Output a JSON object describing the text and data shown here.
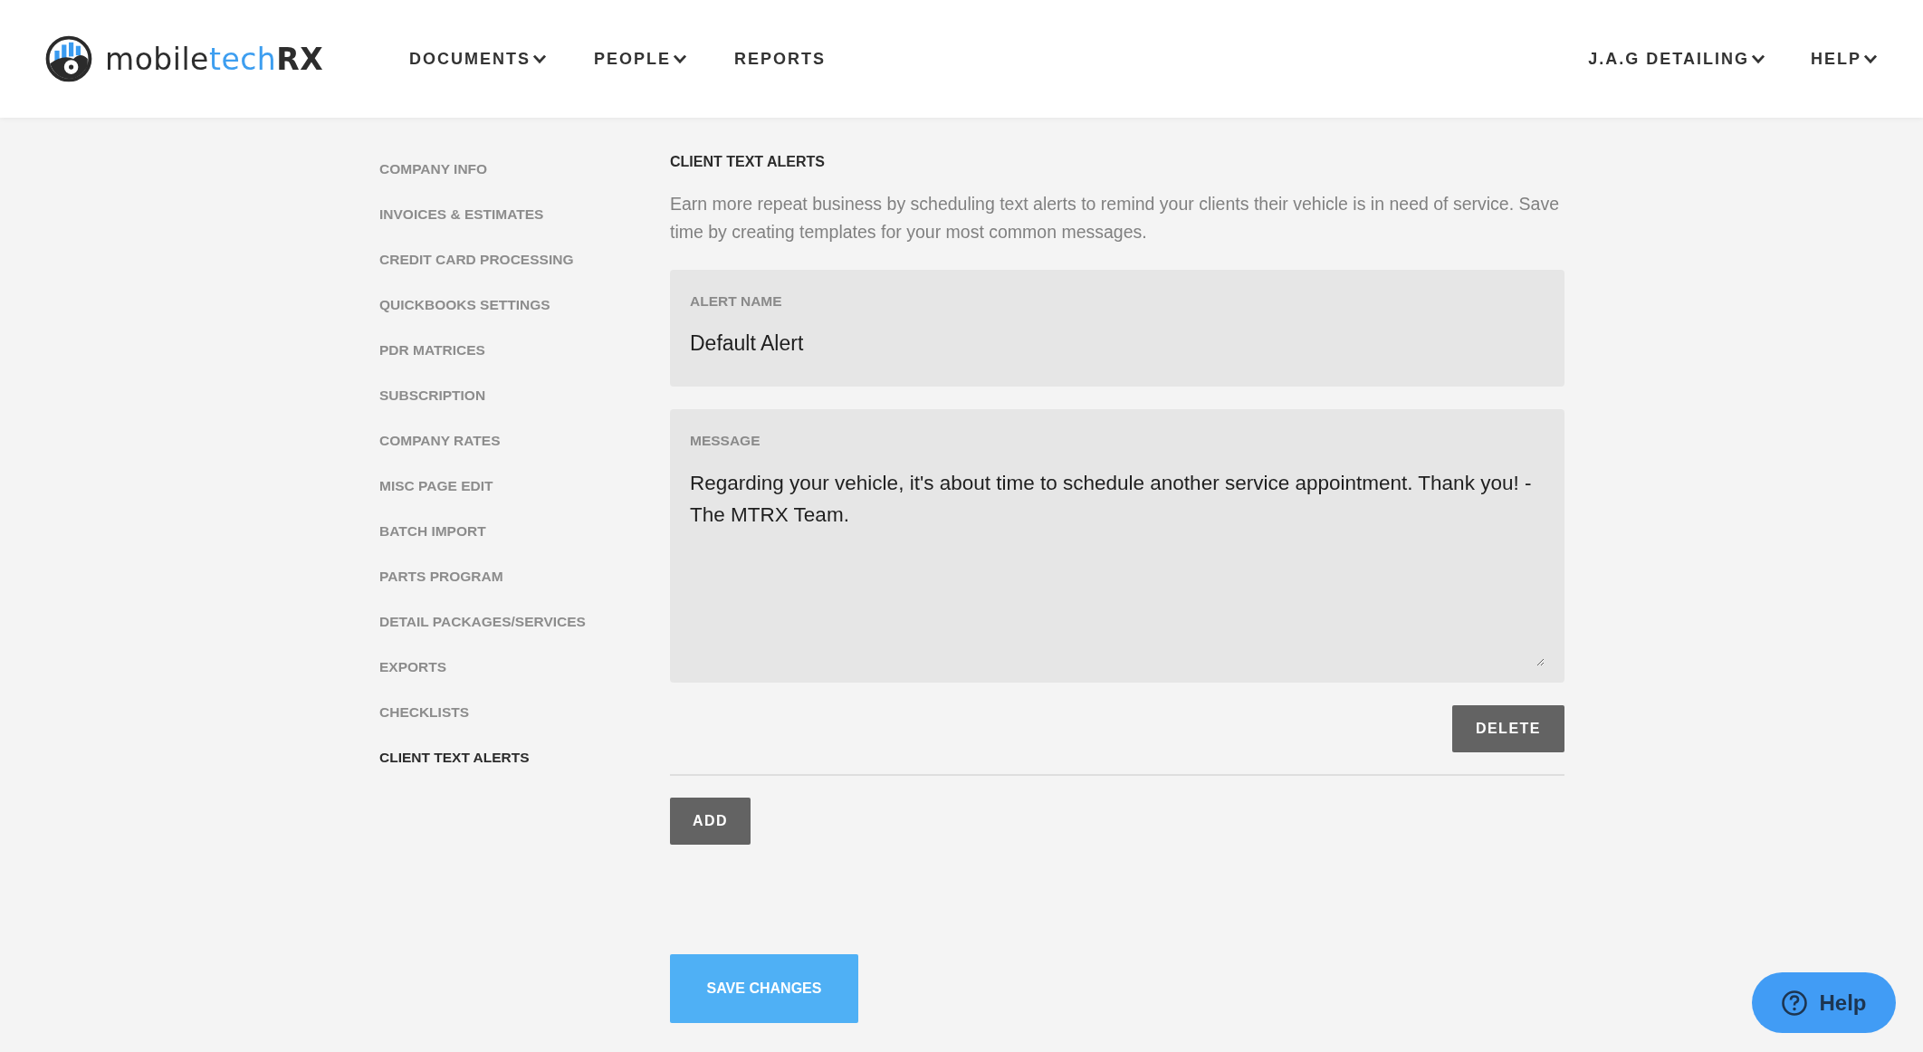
{
  "header": {
    "logo": {
      "prefix": "mobile",
      "accent": "tech",
      "suffix": "RX"
    },
    "nav": [
      {
        "label": "DOCUMENTS",
        "dropdown": true
      },
      {
        "label": "PEOPLE",
        "dropdown": true
      },
      {
        "label": "REPORTS",
        "dropdown": false
      }
    ],
    "nav_right": [
      {
        "label": "J.A.G DETAILING",
        "dropdown": true
      },
      {
        "label": "HELP",
        "dropdown": true
      }
    ]
  },
  "sidebar": {
    "items": [
      {
        "label": "COMPANY INFO",
        "selected": false
      },
      {
        "label": "INVOICES & ESTIMATES",
        "selected": false
      },
      {
        "label": "CREDIT CARD PROCESSING",
        "selected": false
      },
      {
        "label": "QUICKBOOKS SETTINGS",
        "selected": false
      },
      {
        "label": "PDR MATRICES",
        "selected": false
      },
      {
        "label": "SUBSCRIPTION",
        "selected": false
      },
      {
        "label": "COMPANY RATES",
        "selected": false
      },
      {
        "label": "MISC PAGE EDIT",
        "selected": false
      },
      {
        "label": "BATCH IMPORT",
        "selected": false
      },
      {
        "label": "PARTS PROGRAM",
        "selected": false
      },
      {
        "label": "DETAIL PACKAGES/SERVICES",
        "selected": false
      },
      {
        "label": "EXPORTS",
        "selected": false
      },
      {
        "label": "CHECKLISTS",
        "selected": false
      },
      {
        "label": "CLIENT TEXT ALERTS",
        "selected": true
      }
    ]
  },
  "main": {
    "title": "CLIENT TEXT ALERTS",
    "description": "Earn more repeat business by scheduling text alerts to remind your clients their vehicle is in need of service. Save time by creating templates for your most common messages.",
    "alerts": [
      {
        "name_label": "ALERT NAME",
        "name": "Default Alert",
        "message_label": "MESSAGE",
        "message": "Regarding your vehicle, it's about time to schedule another service appointment. Thank you! - The MTRX Team.",
        "delete_button": "DELETE"
      }
    ],
    "add_button": "ADD",
    "save_button": "SAVE CHANGES"
  },
  "help_widget": {
    "label": "Help"
  }
}
